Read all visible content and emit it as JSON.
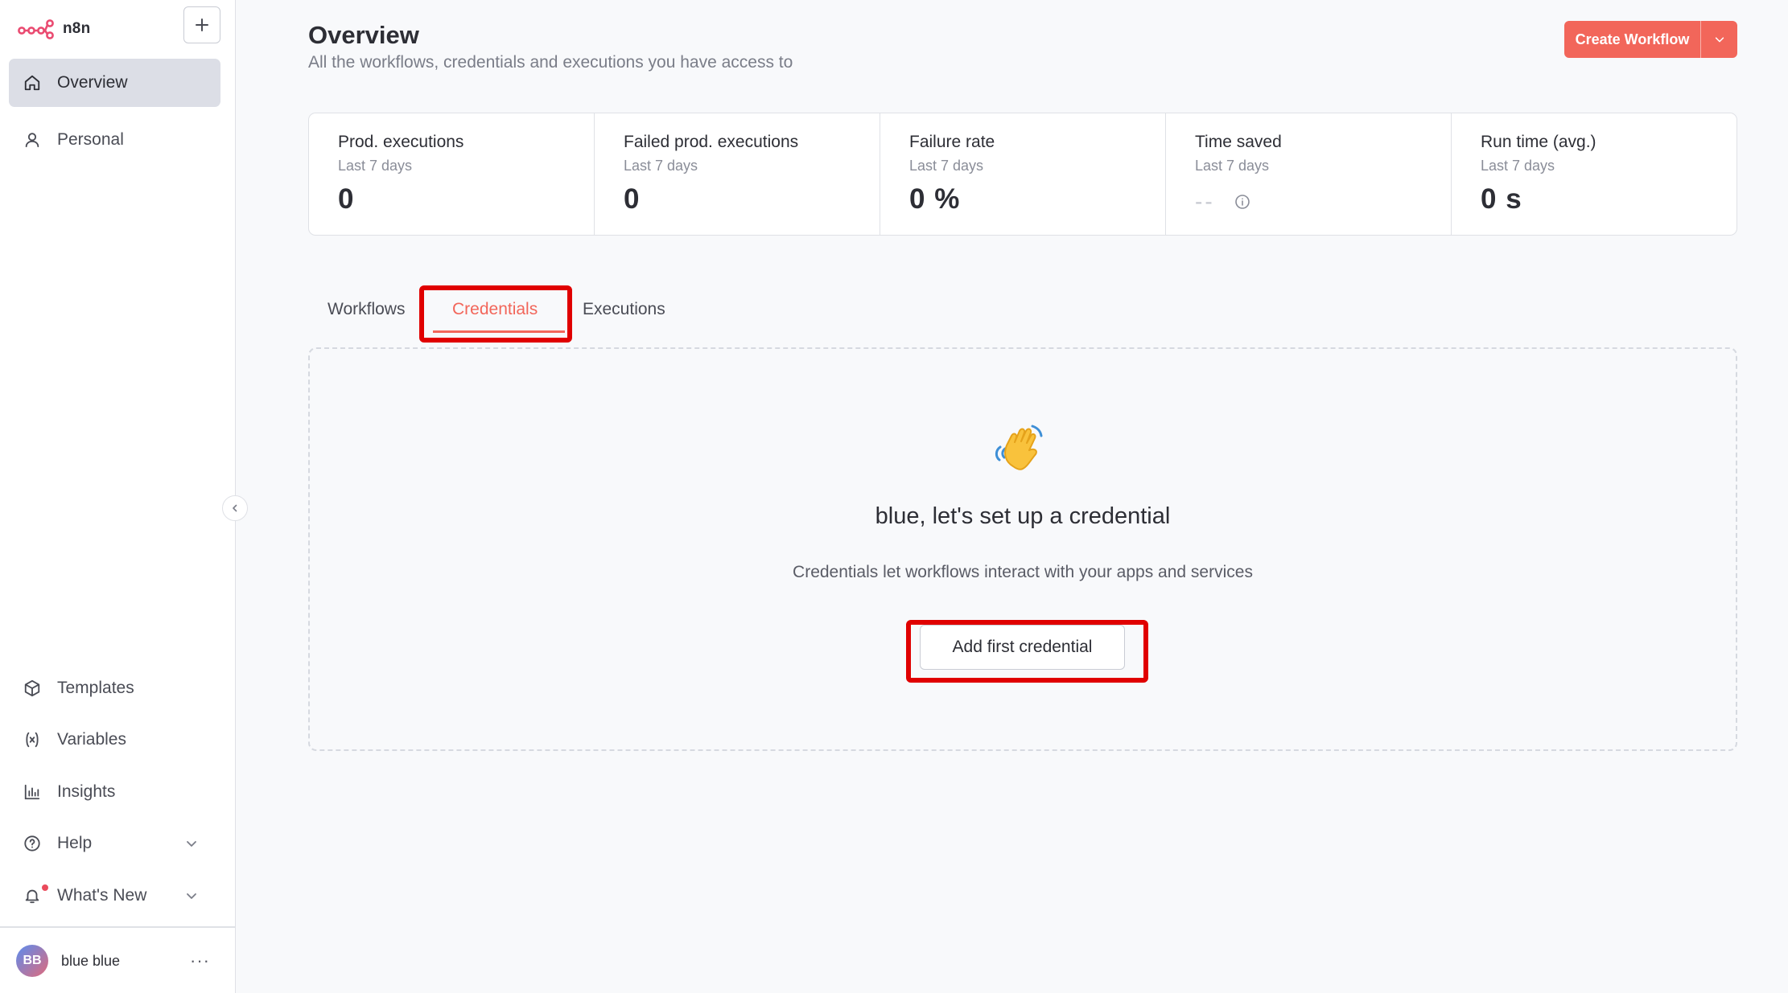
{
  "app": {
    "logo_text": "n8n"
  },
  "sidebar": {
    "top_items": [
      {
        "label": "Overview",
        "icon": "home-icon",
        "active": true
      },
      {
        "label": "Personal",
        "icon": "user-icon",
        "active": false
      }
    ],
    "bottom_items": [
      {
        "label": "Templates",
        "icon": "box-icon"
      },
      {
        "label": "Variables",
        "icon": "variable-icon"
      },
      {
        "label": "Insights",
        "icon": "chart-icon"
      },
      {
        "label": "Help",
        "icon": "help-icon"
      },
      {
        "label": "What's New",
        "icon": "bell-icon"
      }
    ],
    "user": {
      "initials": "BB",
      "name": "blue blue"
    }
  },
  "header": {
    "title": "Overview",
    "subtitle": "All the workflows, credentials and executions you have access to",
    "create_button": "Create Workflow"
  },
  "stats": [
    {
      "label": "Prod. executions",
      "period": "Last 7 days",
      "value": "0"
    },
    {
      "label": "Failed prod. executions",
      "period": "Last 7 days",
      "value": "0"
    },
    {
      "label": "Failure rate",
      "period": "Last 7 days",
      "value": "0 %"
    },
    {
      "label": "Time saved",
      "period": "Last 7 days",
      "value": "--"
    },
    {
      "label": "Run time (avg.)",
      "period": "Last 7 days",
      "value": "0 s"
    }
  ],
  "tabs": [
    {
      "label": "Workflows",
      "active": false
    },
    {
      "label": "Credentials",
      "active": true
    },
    {
      "label": "Executions",
      "active": false
    }
  ],
  "empty_state": {
    "heading": "blue, let's set up a credential",
    "description": "Credentials let workflows interact with your apps and services",
    "button": "Add first credential"
  },
  "colors": {
    "accent": "#f2665a",
    "highlight": "#e00000"
  }
}
